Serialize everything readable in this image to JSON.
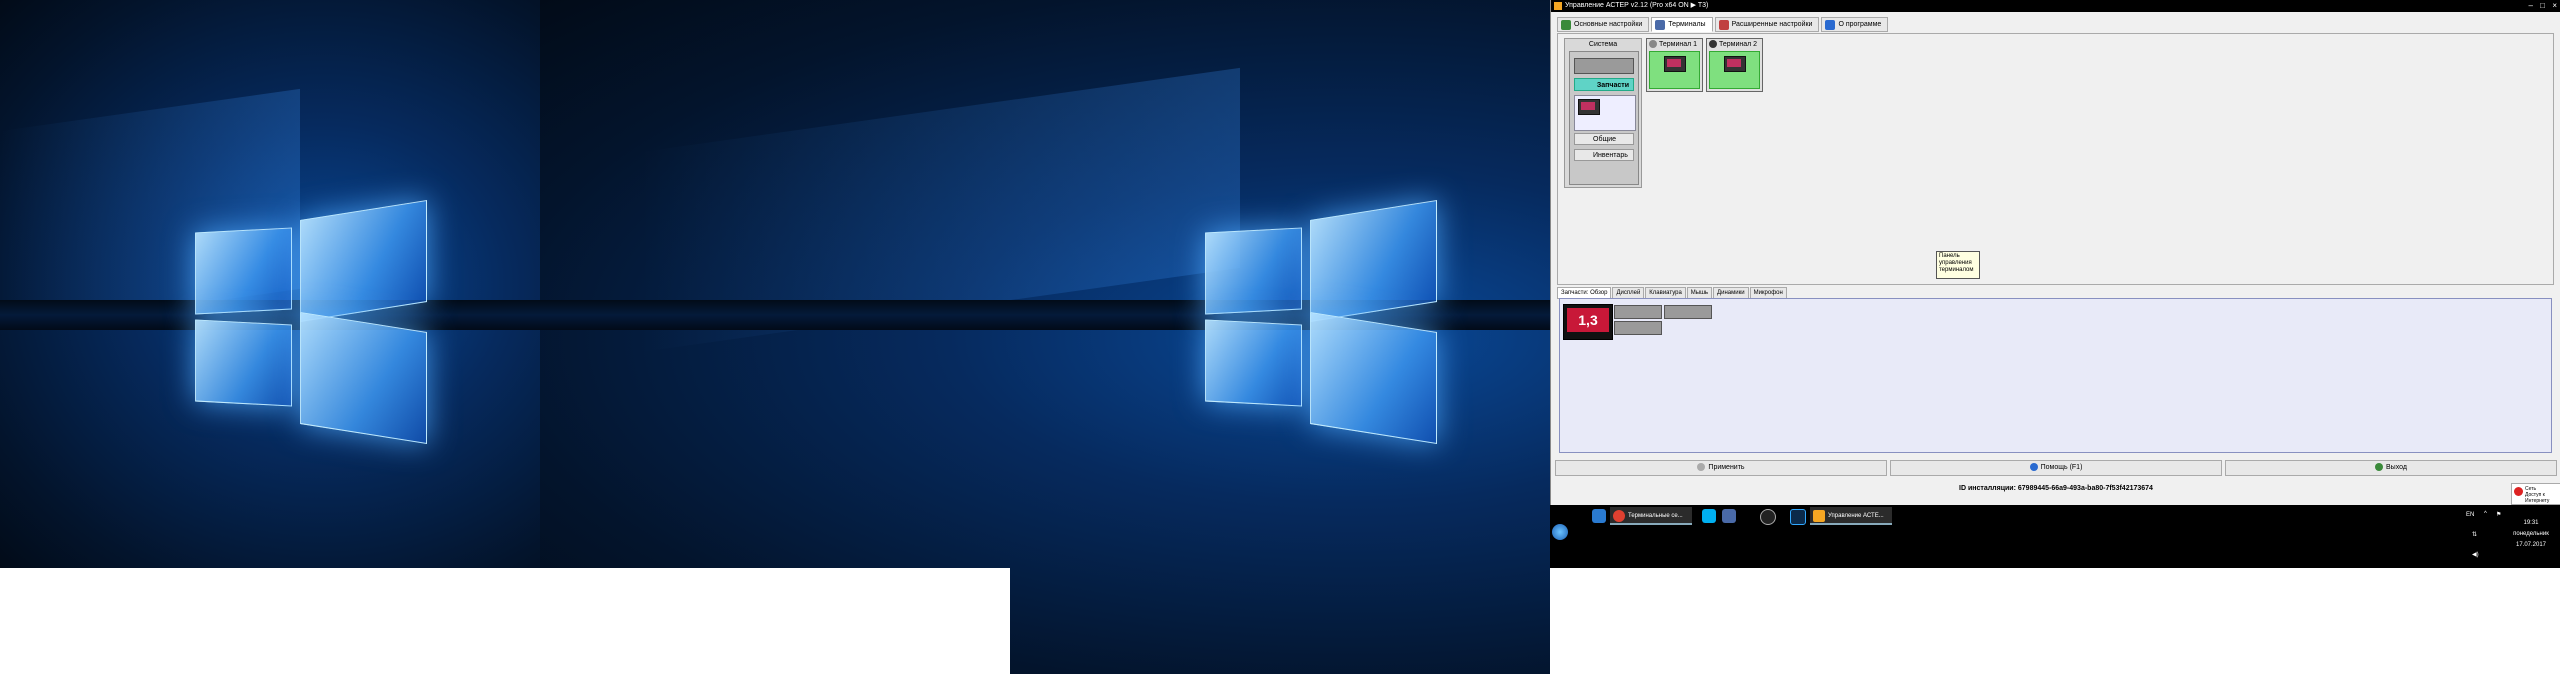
{
  "window": {
    "title": "Управление АСТЕР v2.12 (Pro x64 ON ▶ T3)",
    "controls": {
      "minimize": "–",
      "maximize": "□",
      "close": "×"
    }
  },
  "tabs": [
    {
      "label": "Основные настройки",
      "icon": "settings-icon",
      "color": "#3a8a3a"
    },
    {
      "label": "Терминалы",
      "icon": "terminals-icon",
      "color": "#4a6aa8"
    },
    {
      "label": "Расширенные настройки",
      "icon": "tools-icon",
      "color": "#c04040"
    },
    {
      "label": "О программе",
      "icon": "info-icon",
      "color": "#2a6ad0"
    }
  ],
  "system": {
    "header": "Система",
    "parts_button": "Запчасти",
    "common_button": "Общие",
    "inventory_button": "Инвентарь"
  },
  "terminals": [
    {
      "label": "Терминал 1"
    },
    {
      "label": "Терминал 2"
    }
  ],
  "tooltip": {
    "text": "Панель управления терминалом"
  },
  "subtabs": [
    "Запчасти: Обзор",
    "Дисплей",
    "Клавиатура",
    "Мышь",
    "Динамики",
    "Микрофон"
  ],
  "preview": {
    "big_label": "1,3"
  },
  "actions": {
    "apply": "Применить",
    "help": "Помощь (F1)",
    "exit": "Выход"
  },
  "install_id": "ID инсталляции: 67989445-66a9-493a-ba80-7f53f42173674",
  "notification": {
    "line1": "Сеть",
    "line2": "Доступ к Интернету"
  },
  "taskbar": {
    "buttons": [
      {
        "label": "Терминальные се..."
      },
      {
        "label": "Управление АСТЕ..."
      }
    ],
    "lang": "EN",
    "time": "19:31",
    "day": "понедельник",
    "date": "17.07.2017"
  }
}
